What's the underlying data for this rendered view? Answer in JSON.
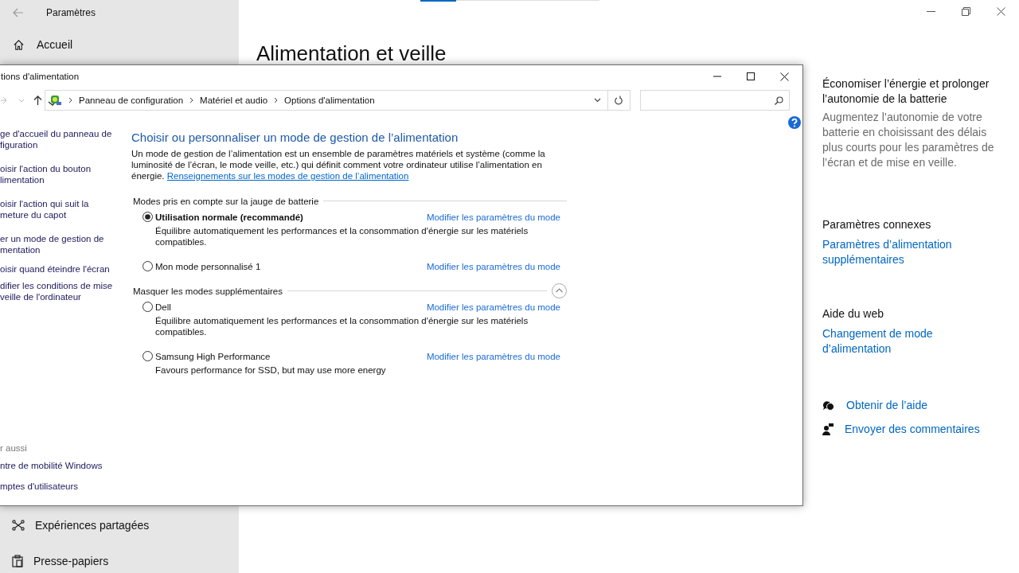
{
  "settings": {
    "title": "Paramètres",
    "home": "Accueil",
    "nav_items": [
      {
        "kind": "shared",
        "label": "Expériences partagées"
      },
      {
        "kind": "clipboard",
        "label": "Presse-papiers"
      }
    ],
    "page_title": "Alimentation et veille",
    "progress": {
      "level": 0.2
    },
    "side": {
      "tip_title": "Économiser l’énergie et prolonger l’autonomie de la batterie",
      "tip_text": "Augmentez l’autonomie de votre batterie en choisissant des délais plus courts pour les paramètres de l’écran et de mise en veille.",
      "related_heading": "Paramètres connexes",
      "related_link": "Paramètres d’alimentation supplémentaires",
      "web_heading": "Aide du web",
      "web_link": "Changement de mode d’alimentation",
      "help_links": [
        {
          "kind": "help",
          "label": "Obtenir de l’aide"
        },
        {
          "kind": "feedback",
          "label": "Envoyer des commentaires"
        }
      ]
    }
  },
  "control_panel": {
    "title": "tions d'alimentation",
    "breadcrumb": [
      "Panneau de configuration",
      "Matériel et audio",
      "Options d'alimentation"
    ],
    "sidebar": {
      "links": [
        [
          "ge d'accueil du panneau de",
          "figuration"
        ],
        [
          "oisir l'action du bouton",
          "limentation"
        ],
        [
          "oisir l'action qui suit la",
          "meture du capot"
        ],
        [
          "er un mode de gestion de",
          "mentation"
        ],
        [
          "oisir quand éteindre l'écran"
        ],
        [
          "difier les conditions de mise",
          "veille de l'ordinateur"
        ]
      ],
      "see_also_heading": "r aussi",
      "see_also": [
        "ntre de mobilité Windows",
        "mptes d'utilisateurs"
      ]
    },
    "heading": "Choisir ou personnaliser un mode de gestion de l’alimentation",
    "intro": "Un mode de gestion de l’alimentation est un ensemble de paramètres matériels et système (comme la luminosité de l’écran, le mode veille, etc.) qui définit comment votre ordinateur utilise l’alimentation en énergie.",
    "intro_link": "Renseignements sur les modes de gestion de l’alimentation",
    "groups": [
      {
        "kind": "fixed",
        "heading": "Modes pris en compte sur la jauge de batterie",
        "plans": [
          {
            "name": "Utilisation normale (recommandé)",
            "selected": true,
            "description": "Équilibre automatiquement les performances et la consommation d'énergie sur les matériels compatibles.",
            "link": "Modifier les paramètres du mode"
          },
          {
            "name": "Mon mode personnalisé 1",
            "selected": false,
            "link": "Modifier les paramètres du mode"
          }
        ]
      },
      {
        "kind": "collapsible",
        "expanded": true,
        "heading": "Masquer les modes supplémentaires",
        "plans": [
          {
            "name": "Dell",
            "selected": false,
            "description": "Équilibre automatiquement les performances et la consommation d'énergie sur les matériels compatibles.",
            "link": "Modifier les paramètres du mode"
          },
          {
            "name": "Samsung High Performance",
            "selected": false,
            "description": "Favours performance for SSD, but may use more energy",
            "link": "Modifier les paramètres du mode"
          }
        ]
      }
    ]
  }
}
